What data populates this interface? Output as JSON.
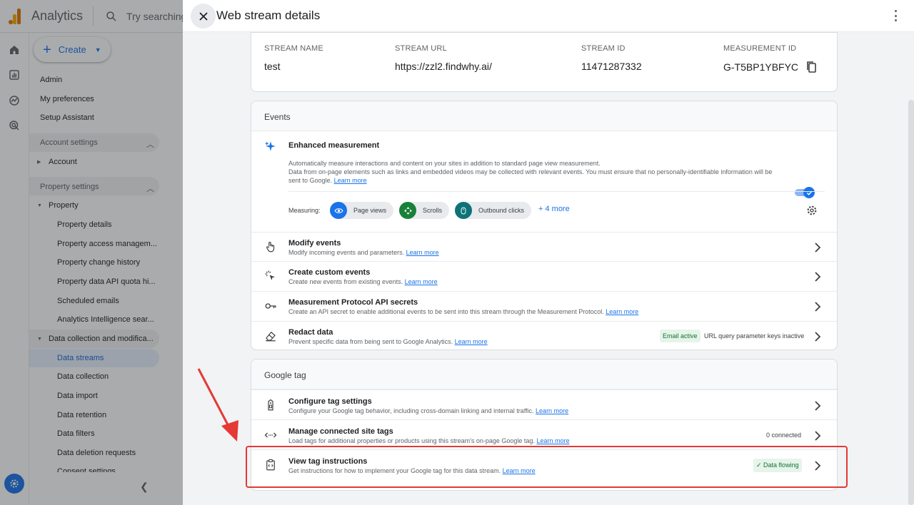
{
  "app": {
    "name": "Analytics",
    "search_placeholder": "Try searching"
  },
  "sidenav": {
    "create_label": "Create",
    "top_items": [
      "Admin",
      "My preferences",
      "Setup Assistant"
    ],
    "account_settings": "Account settings",
    "account": "Account",
    "property_settings": "Property settings",
    "property": "Property",
    "property_items": [
      "Property details",
      "Property access managem...",
      "Property change history",
      "Property data API quota hi...",
      "Scheduled emails",
      "Analytics Intelligence sear..."
    ],
    "data_collection": "Data collection and modifica...",
    "data_items": [
      "Data streams",
      "Data collection",
      "Data import",
      "Data retention",
      "Data filters",
      "Data deletion requests",
      "Consent settings"
    ]
  },
  "panel": {
    "title": "Web stream details",
    "stream": {
      "name_label": "STREAM NAME",
      "name": "test",
      "url_label": "STREAM URL",
      "url": "https://zzl2.findwhy.ai/",
      "id_label": "STREAM ID",
      "id": "11471287332",
      "mid_label": "MEASUREMENT ID",
      "mid": "G-T5BP1YBFYC"
    },
    "events": {
      "title": "Events",
      "enhanced": {
        "title": "Enhanced measurement",
        "desc1": "Automatically measure interactions and content on your sites in addition to standard page view measurement.",
        "desc2": "Data from on-page elements such as links and embedded videos may be collected with relevant events. You must ensure that no personally-identifiable information will be",
        "desc3": "sent to Google.",
        "learn_more": "Learn more",
        "measuring_label": "Measuring:",
        "chips": [
          "Page views",
          "Scrolls",
          "Outbound clicks"
        ],
        "more": "+ 4 more"
      },
      "rows": [
        {
          "title": "Modify events",
          "desc": "Modify incoming events and parameters.",
          "link": "Learn more"
        },
        {
          "title": "Create custom events",
          "desc": "Create new events from existing events.",
          "link": "Learn more"
        },
        {
          "title": "Measurement Protocol API secrets",
          "desc": "Create an API secret to enable additional events to be sent into this stream through the Measurement Protocol.",
          "link": "Learn more"
        },
        {
          "title": "Redact data",
          "desc": "Prevent specific data from being sent to Google Analytics.",
          "link": "Learn more",
          "badge_green": "Email active",
          "badge_plain": "URL query parameter keys inactive"
        }
      ]
    },
    "google_tag": {
      "title": "Google tag",
      "rows": [
        {
          "title": "Configure tag settings",
          "desc": "Configure your Google tag behavior, including cross-domain linking and internal traffic.",
          "link": "Learn more"
        },
        {
          "title": "Manage connected site tags",
          "desc": "Load tags for additional properties or products using this stream's on-page Google tag.",
          "link": "Learn more",
          "status": "0 connected"
        },
        {
          "title": "View tag instructions",
          "desc": "Get instructions for how to implement your Google tag for this data stream.",
          "link": "Learn more",
          "status": "Data flowing"
        }
      ]
    }
  },
  "colors": {
    "accent": "#1a73e8",
    "highlight": "#e53935"
  }
}
